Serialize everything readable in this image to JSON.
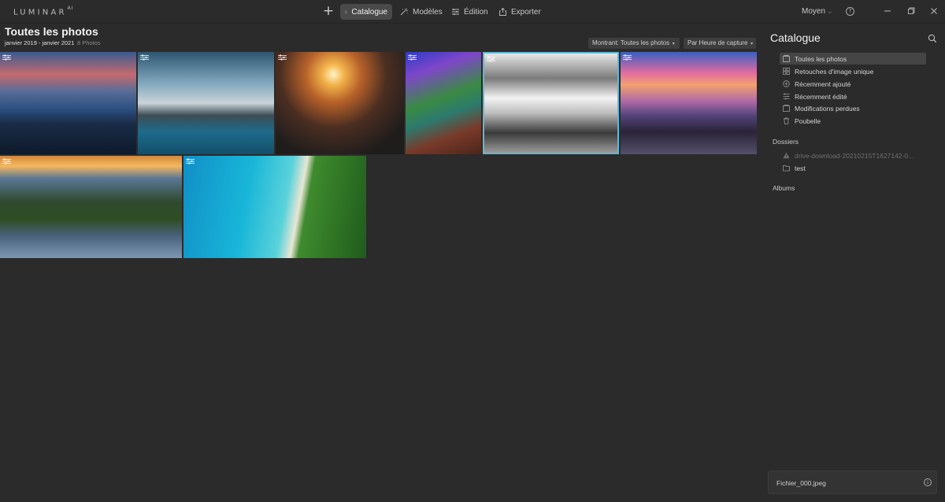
{
  "app": {
    "logo": "LUMINAR",
    "logo_suffix": "AI"
  },
  "topbar": {
    "tabs": [
      {
        "label": "Catalogue",
        "icon": "folder-icon",
        "active": true
      },
      {
        "label": "Modèles",
        "icon": "magic-wand-icon"
      },
      {
        "label": "Édition",
        "icon": "sliders-icon"
      },
      {
        "label": "Exporter",
        "icon": "share-icon"
      }
    ],
    "quality": "Moyen",
    "help": "?"
  },
  "main": {
    "title": "Toutes les photos",
    "date_range": "janvier 2019 - janvier 2021",
    "count": "8 Photos",
    "filter_label": "Montrant: Toutes les photos",
    "sort_label": "Par Heure de capture",
    "photos": [
      {
        "description": "aerial coastal sunset",
        "edited": true
      },
      {
        "description": "snowy lakeside town",
        "edited": true
      },
      {
        "description": "airplane over city at sunset",
        "edited": true
      },
      {
        "description": "tropical balcony view",
        "edited": true
      },
      {
        "description": "black and white beach",
        "edited": true,
        "selected": true
      },
      {
        "description": "pink sunset boats",
        "edited": true
      },
      {
        "description": "forested peninsula aerial",
        "edited": true
      },
      {
        "description": "turquoise coast aerial",
        "edited": true
      }
    ]
  },
  "sidebar": {
    "title": "Catalogue",
    "items": [
      {
        "label": "Toutes les photos",
        "icon": "photos-icon",
        "active": true
      },
      {
        "label": "Retouches d'image unique",
        "icon": "grid-icon"
      },
      {
        "label": "Récemment ajouté",
        "icon": "plus-circle-icon"
      },
      {
        "label": "Récemment édité",
        "icon": "sliders-icon"
      },
      {
        "label": "Modifications perdues",
        "icon": "photos-icon"
      },
      {
        "label": "Poubelle",
        "icon": "trash-icon"
      }
    ],
    "folders_label": "Dossiers",
    "folders": [
      {
        "label": "drive-download-20210215T1627142-0...",
        "icon": "warning-icon",
        "dim": true
      },
      {
        "label": "test",
        "icon": "folder-icon"
      }
    ],
    "albums_label": "Albums",
    "file": {
      "name": "Fichier_000.jpeg"
    }
  }
}
